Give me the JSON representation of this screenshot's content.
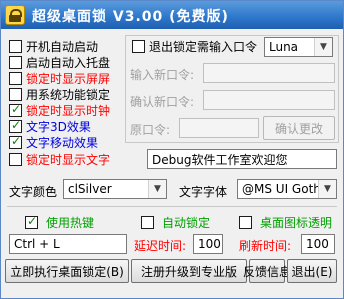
{
  "window": {
    "title": "超级桌面锁 V3.00 (免费版)"
  },
  "options": [
    {
      "label": "开机自动启动",
      "checked": false,
      "color": "black"
    },
    {
      "label": "启动自动入托盘",
      "checked": false,
      "color": "black"
    },
    {
      "label": "锁定时显示屏屏",
      "checked": false,
      "color": "red"
    },
    {
      "label": "用系统功能锁定",
      "checked": false,
      "color": "black"
    },
    {
      "label": "锁定时显示时钟",
      "checked": true,
      "color": "red"
    },
    {
      "label": "文字3D效果",
      "checked": true,
      "color": "blue"
    },
    {
      "label": "文字移动效果",
      "checked": true,
      "color": "blue"
    },
    {
      "label": "锁定时显示文字",
      "checked": false,
      "color": "red"
    }
  ],
  "unlock_panel": {
    "require_password_label": "退出锁定需输入口令",
    "input_method": "Luna",
    "new_password_label": "输入新口令:",
    "confirm_password_label": "确认新口令:",
    "old_password_label": "原口令:",
    "confirm_change_button": "确认更改"
  },
  "lock_text_value": "Debug软件工作室欢迎您",
  "text_color": {
    "label": "文字颜色",
    "value": "clSilver"
  },
  "text_font": {
    "label": "文字字体",
    "value": "@MS UI Gothi"
  },
  "hotkey": {
    "label": "使用热键",
    "checked": true,
    "value": "Ctrl + L"
  },
  "auto_lock": {
    "label": "自动锁定",
    "checked": false,
    "delay_label": "延迟时间:",
    "delay_value": "100"
  },
  "icon_transparent": {
    "label": "桌面图标透明",
    "checked": false,
    "refresh_label": "刷新时间:",
    "refresh_value": "100"
  },
  "buttons": {
    "lock_now": "立即执行桌面锁定(B)",
    "register": "注册升级到专业版",
    "feedback": "反馈信息",
    "exit": "退出(E)"
  },
  "colors": {
    "title_bar": "#2f79cc",
    "red": "#ff0000",
    "blue": "#0000e0",
    "green": "#00a000"
  }
}
